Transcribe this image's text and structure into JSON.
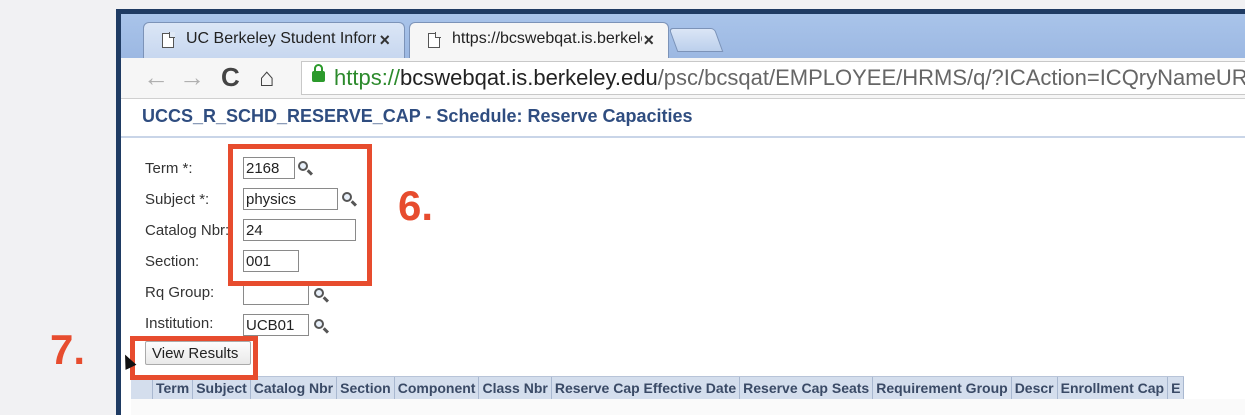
{
  "browser": {
    "tabs": [
      {
        "title": "UC Berkeley Student Inform",
        "close": "×",
        "active": false
      },
      {
        "title": "https://bcswebqat.is.berkele",
        "close": "×",
        "active": true
      }
    ],
    "url": {
      "scheme": "https://",
      "host": "bcswebqat.is.berkeley.edu",
      "path": "/psc/bcsqat/EMPLOYEE/HRMS/q/?ICAction=ICQryNameURL="
    },
    "nav": {
      "back": "←",
      "forward": "→",
      "reload": "C",
      "home": "⌂"
    }
  },
  "page": {
    "title": "UCCS_R_SCHD_RESERVE_CAP - Schedule: Reserve Capacities"
  },
  "form": {
    "term": {
      "label": "Term *:",
      "value": "2168"
    },
    "subject": {
      "label": "Subject *:",
      "value": "physics"
    },
    "catalog": {
      "label": "Catalog Nbr:",
      "value": "24"
    },
    "section": {
      "label": "Section:",
      "value": "001"
    },
    "rq_group": {
      "label": "Rq Group:",
      "value": ""
    },
    "institution": {
      "label": "Institution:",
      "value": "UCB01"
    },
    "view_results": "View Results"
  },
  "results_grid": {
    "columns": [
      "Term",
      "Subject",
      "Catalog Nbr",
      "Section",
      "Component",
      "Class Nbr",
      "Reserve Cap Effective Date",
      "Reserve Cap Seats",
      "Requirement Group",
      "Descr",
      "Enrollment Cap",
      "E"
    ]
  },
  "annotations": {
    "step6": "6.",
    "step7": "7."
  },
  "colors": {
    "annotation": "#e74c2e",
    "title": "#2f4d80",
    "frame": "#1f3b63"
  }
}
